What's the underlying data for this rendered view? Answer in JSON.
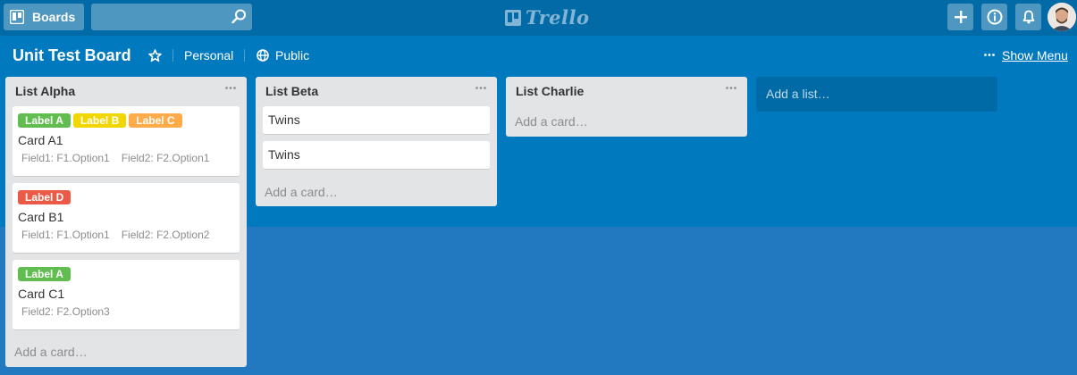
{
  "header": {
    "boards_label": "Boards",
    "search_value": "",
    "logo_text": "Trello"
  },
  "board": {
    "title": "Unit Test Board",
    "team": "Personal",
    "visibility": "Public",
    "show_menu": "Show Menu"
  },
  "colors": {
    "board_bg": "#0079bf",
    "header_bg": "#026aa7",
    "label_green": "#61bd4f",
    "label_yellow": "#f2d600",
    "label_orange": "#ffab4a",
    "label_red": "#eb5a46"
  },
  "lists": [
    {
      "title": "List Alpha",
      "add_card": "Add a card…",
      "cards": [
        {
          "labels": [
            {
              "text": "Label A",
              "color": "#61bd4f"
            },
            {
              "text": "Label B",
              "color": "#f2d600"
            },
            {
              "text": "Label C",
              "color": "#ffab4a"
            }
          ],
          "title": "Card A1",
          "fields": [
            "Field1: F1.Option1",
            "Field2: F2.Option1"
          ]
        },
        {
          "labels": [
            {
              "text": "Label D",
              "color": "#eb5a46"
            }
          ],
          "title": "Card B1",
          "fields": [
            "Field1: F1.Option1",
            "Field2: F2.Option2"
          ]
        },
        {
          "labels": [
            {
              "text": "Label A",
              "color": "#61bd4f"
            }
          ],
          "title": "Card C1",
          "fields": [
            "Field2: F2.Option3"
          ]
        }
      ]
    },
    {
      "title": "List Beta",
      "add_card": "Add a card…",
      "cards": [
        {
          "title": "Twins"
        },
        {
          "title": "Twins"
        }
      ]
    },
    {
      "title": "List Charlie",
      "add_card": "Add a card…",
      "cards": []
    }
  ],
  "add_list": "Add a list…"
}
